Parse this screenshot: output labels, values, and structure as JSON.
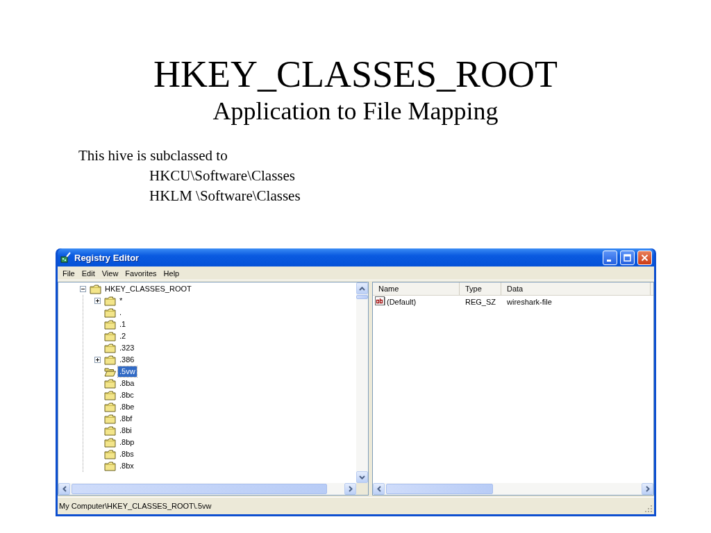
{
  "slide": {
    "title": "HKEY_CLASSES_ROOT",
    "subtitle": "Application to File Mapping",
    "body": "This hive is subclassed to",
    "paths": [
      "HKCU\\Software\\Classes",
      "HKLM \\Software\\Classes"
    ]
  },
  "window": {
    "title": "Registry Editor"
  },
  "menu": [
    "File",
    "Edit",
    "View",
    "Favorites",
    "Help"
  ],
  "tree": {
    "label": "HKEY_CLASSES_ROOT",
    "expanded": true,
    "selected": false,
    "children": [
      {
        "label": "*",
        "expandable": true,
        "selected": false
      },
      {
        "label": ".",
        "expandable": false,
        "selected": false
      },
      {
        "label": ".1",
        "expandable": false,
        "selected": false
      },
      {
        "label": ".2",
        "expandable": false,
        "selected": false
      },
      {
        "label": ".323",
        "expandable": false,
        "selected": false
      },
      {
        "label": ".386",
        "expandable": true,
        "selected": false
      },
      {
        "label": ".5vw",
        "expandable": false,
        "selected": true
      },
      {
        "label": ".8ba",
        "expandable": false,
        "selected": false
      },
      {
        "label": ".8bc",
        "expandable": false,
        "selected": false
      },
      {
        "label": ".8be",
        "expandable": false,
        "selected": false
      },
      {
        "label": ".8bf",
        "expandable": false,
        "selected": false
      },
      {
        "label": ".8bi",
        "expandable": false,
        "selected": false
      },
      {
        "label": ".8bp",
        "expandable": false,
        "selected": false
      },
      {
        "label": ".8bs",
        "expandable": false,
        "selected": false
      },
      {
        "label": ".8bx",
        "expandable": false,
        "selected": false
      }
    ]
  },
  "values": {
    "columns": [
      "Name",
      "Type",
      "Data"
    ],
    "rows": [
      {
        "name": "(Default)",
        "type": "REG_SZ",
        "data": "wireshark-file"
      }
    ]
  },
  "status_bar": "My Computer\\HKEY_CLASSES_ROOT\\.5vw"
}
